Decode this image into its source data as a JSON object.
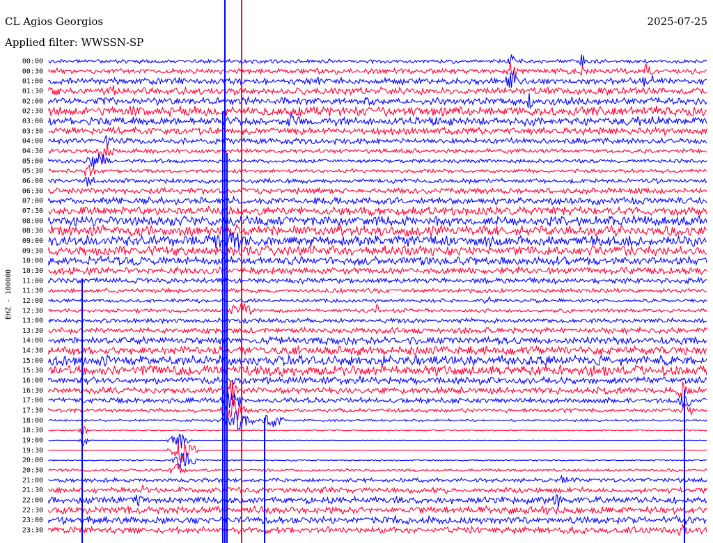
{
  "header": {
    "station": "CL Agios Georgios",
    "date": "2025-07-25",
    "filter": "Applied filter: WWSSN-SP"
  },
  "chart_data": {
    "type": "line",
    "title": "CL Agios Georgios",
    "subtitle": "Applied filter: WWSSN-SP",
    "ylabel": "EHZ - 100000",
    "xlabel": "",
    "row_labels": [
      "00:00",
      "00:30",
      "01:00",
      "01:30",
      "02:00",
      "02:30",
      "03:00",
      "03:30",
      "04:00",
      "04:30",
      "05:00",
      "05:30",
      "06:00",
      "06:30",
      "07:00",
      "07:30",
      "08:00",
      "08:30",
      "09:00",
      "09:30",
      "10:00",
      "10:30",
      "11:00",
      "11:30",
      "12:00",
      "12:30",
      "13:00",
      "13:30",
      "14:00",
      "14:30",
      "15:00",
      "15:30",
      "16:00",
      "16:30",
      "17:00",
      "17:30",
      "18:00",
      "18:30",
      "19:00",
      "19:30",
      "20:00",
      "20:30",
      "21:00",
      "21:30",
      "22:00",
      "22:30",
      "23:00",
      "23:30"
    ],
    "series_colors": [
      "#0000ff",
      "#ff0033"
    ],
    "grid": false
  }
}
